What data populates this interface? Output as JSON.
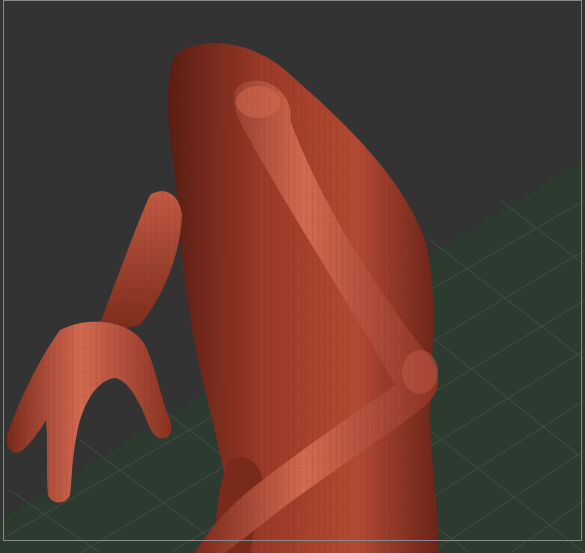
{
  "viewport": {
    "background": "#333333",
    "frame_color": "#8a8a8a"
  },
  "floor_grid": {
    "fill": "#2d3a2f",
    "line_color": "#3f5444"
  },
  "mesh": {
    "base_color": "#9a3a27",
    "highlight_color": "#d46a52",
    "shadow_color": "#5a1d12",
    "wireframe_color": "#6e2416"
  }
}
